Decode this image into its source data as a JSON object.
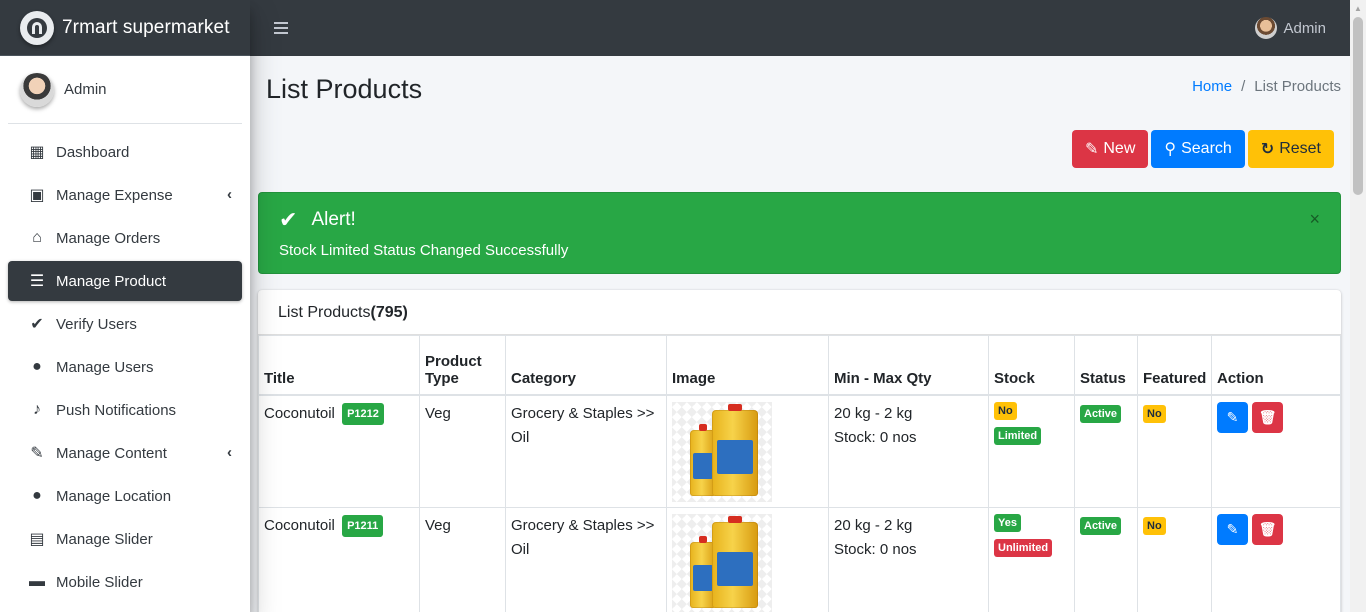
{
  "app": {
    "brand": "7rmart supermarket",
    "user": "Admin"
  },
  "sidebar": {
    "user_name": "Admin",
    "items": [
      {
        "label": "Dashboard",
        "icon": "dashboard-icon",
        "glyph": "▦",
        "active": false,
        "chevron": false
      },
      {
        "label": "Manage Expense",
        "icon": "money-bill-icon",
        "glyph": "▣",
        "active": false,
        "chevron": true
      },
      {
        "label": "Manage Orders",
        "icon": "basket-icon",
        "glyph": "⌂",
        "active": false,
        "chevron": false
      },
      {
        "label": "Manage Product",
        "icon": "list-check-icon",
        "glyph": "☰",
        "active": true,
        "chevron": false
      },
      {
        "label": "Verify Users",
        "icon": "user-check-icon",
        "glyph": "✔",
        "active": false,
        "chevron": false
      },
      {
        "label": "Manage Users",
        "icon": "user-icon",
        "glyph": "●",
        "active": false,
        "chevron": false
      },
      {
        "label": "Push Notifications",
        "icon": "bell-icon",
        "glyph": "♪",
        "active": false,
        "chevron": false
      },
      {
        "label": "Manage Content",
        "icon": "edit-icon",
        "glyph": "✎",
        "active": false,
        "chevron": true
      },
      {
        "label": "Manage Location",
        "icon": "map-marker-icon",
        "glyph": "●",
        "active": false,
        "chevron": false
      },
      {
        "label": "Manage Slider",
        "icon": "images-icon",
        "glyph": "▤",
        "active": false,
        "chevron": false
      },
      {
        "label": "Mobile Slider",
        "icon": "minus-icon",
        "glyph": "▬",
        "active": false,
        "chevron": false
      }
    ]
  },
  "header": {
    "title": "List Products",
    "breadcrumb": {
      "home": "Home",
      "sep": "/",
      "current": "List Products"
    }
  },
  "toolbar": {
    "new_label": "New",
    "search_label": "Search",
    "reset_label": "Reset"
  },
  "alert": {
    "title": "Alert!",
    "message": "Stock Limited Status Changed Successfully",
    "close": "×"
  },
  "card": {
    "title": "List Products",
    "count": "(795)"
  },
  "table": {
    "columns": [
      "Title",
      "Product Type",
      "Category",
      "Image",
      "Min - Max Qty",
      "Stock",
      "Status",
      "Featured",
      "Action"
    ],
    "rows": [
      {
        "title": "Coconutoil",
        "code": "P1212",
        "type": "Veg",
        "category": "Grocery & Staples >> Oil",
        "qty": "20 kg - 2 kg",
        "stock_text": "Stock: 0 nos",
        "stock": "No",
        "limit": "Limited",
        "status": "Active",
        "featured": "No"
      },
      {
        "title": "Coconutoil",
        "code": "P1211",
        "type": "Veg",
        "category": "Grocery & Staples >> Oil",
        "qty": "20 kg - 2 kg",
        "stock_text": "Stock: 0 nos",
        "stock": "Yes",
        "limit": "Unlimited",
        "status": "Active",
        "featured": "No"
      }
    ]
  },
  "colors": {
    "topbar": "#343a40",
    "success": "#28a745",
    "primary": "#007bff",
    "danger": "#dc3545",
    "warning": "#ffc107"
  }
}
